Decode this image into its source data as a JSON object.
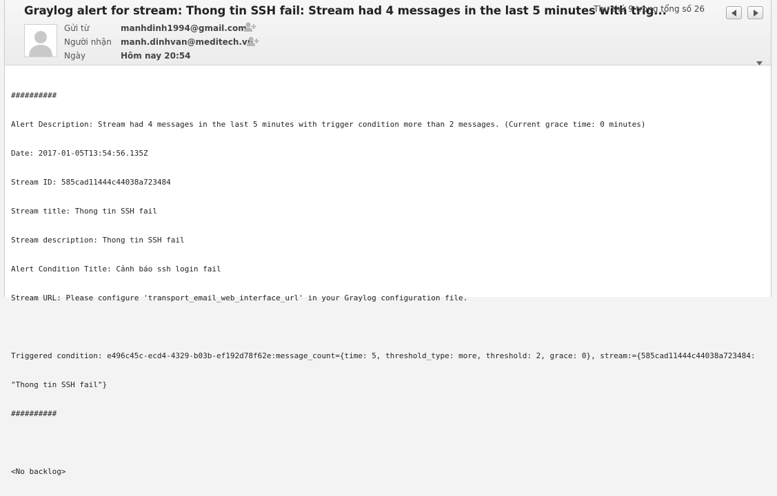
{
  "header": {
    "subject": "Graylog alert for stream: Thong tin SSH fail: Stream had 4 messages in the last 5 minutes with trig...",
    "position_text": "Thư thứ 9 trong tổng số 26"
  },
  "fields": {
    "from_label": "Gửi từ",
    "from_value": "manhdinh1994@gmail.com",
    "to_label": "Người nhận",
    "to_value": "manh.dinhvan@meditech.vn",
    "date_label": "Ngày",
    "date_value": "Hôm nay 20:54"
  },
  "icons": {
    "prev": "chevron-left-icon",
    "next": "chevron-right-icon",
    "add_contact": "add-contact-icon",
    "avatar": "person-silhouette",
    "collapse": "chevron-down-icon"
  },
  "body": {
    "lines": [
      "##########",
      "Alert Description: Stream had 4 messages in the last 5 minutes with trigger condition more than 2 messages. (Current grace time: 0 minutes)",
      "Date: 2017-01-05T13:54:56.135Z",
      "Stream ID: 585cad11444c44038a723484",
      "Stream title: Thong tin SSH fail",
      "Stream description: Thong tin SSH fail",
      "Alert Condition Title: Cảnh báo ssh login fail",
      "Stream URL: Please configure 'transport_email_web_interface_url' in your Graylog configuration file.",
      "",
      "Triggered condition: e496c45c-ecd4-4329-b03b-ef192d78f62e:message_count={time: 5, threshold_type: more, threshold: 2, grace: 0}, stream:={585cad11444c44038a723484:",
      "\"Thong tin SSH fail\"}",
      "##########",
      "",
      "<No backlog>"
    ]
  },
  "colors": {
    "header_bg": "#efefef",
    "text": "#222222",
    "label": "#555555"
  }
}
